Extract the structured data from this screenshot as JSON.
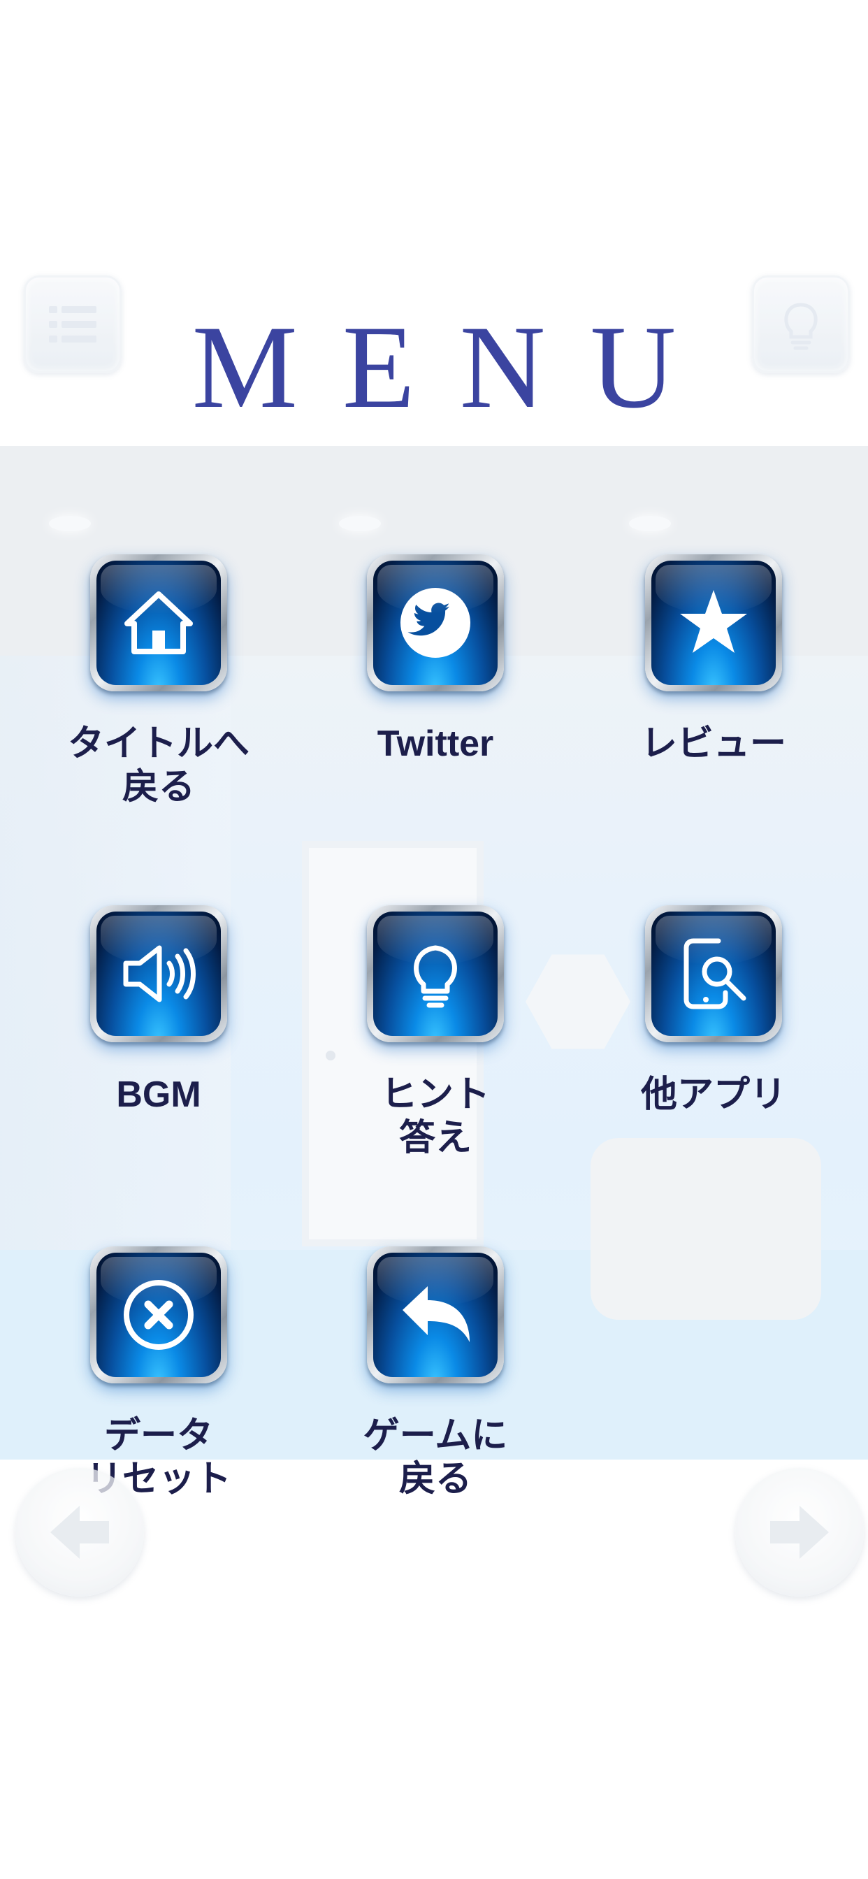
{
  "title": "MENU",
  "header": {
    "left_button_icon": "list-icon",
    "right_button_icon": "lightbulb-icon"
  },
  "menu_items": [
    {
      "icon": "home-icon",
      "label": "タイトルへ\n戻る"
    },
    {
      "icon": "twitter-icon",
      "label": "Twitter"
    },
    {
      "icon": "star-icon",
      "label": "レビュー"
    },
    {
      "icon": "speaker-icon",
      "label": "BGM"
    },
    {
      "icon": "lightbulb-icon",
      "label": "ヒント\n答え"
    },
    {
      "icon": "phone-search-icon",
      "label": "他アプリ"
    },
    {
      "icon": "close-circle-icon",
      "label": "データ\nリセット"
    },
    {
      "icon": "return-arrow-icon",
      "label": "ゲームに\n戻る"
    }
  ],
  "footer": {
    "left_arrow_icon": "arrow-left-icon",
    "right_arrow_icon": "arrow-right-icon"
  },
  "colors": {
    "title": "#3b44a0",
    "label": "#1c1e4b",
    "button_face": "#074f9e",
    "button_glow": "#39c4ff"
  }
}
